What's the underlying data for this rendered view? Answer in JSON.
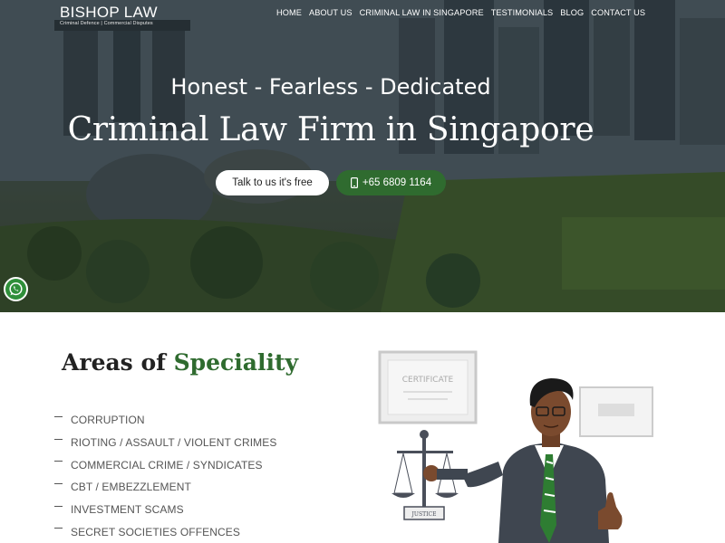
{
  "header": {
    "logo_name": "BISHOP LAW",
    "logo_tagline": "Criminal Defence | Commercial Disputes",
    "nav": [
      {
        "label": "HOME"
      },
      {
        "label": "ABOUT US"
      },
      {
        "label": "CRIMINAL LAW IN SINGAPORE"
      },
      {
        "label": "TESTIMONIALS"
      },
      {
        "label": "BLOG"
      },
      {
        "label": "CONTACT US"
      }
    ]
  },
  "hero": {
    "tagline": "Honest - Fearless - Dedicated",
    "headline": "Criminal Law Firm in Singapore",
    "cta_talk": "Talk to us it's free",
    "cta_phone": "+65 6809 1164",
    "phone_icon": "mobile-phone-icon",
    "whatsapp_icon": "whatsapp-icon"
  },
  "areas": {
    "title_prefix": "Areas of ",
    "title_accent": "Speciality",
    "items": [
      "CORRUPTION",
      "RIOTING / ASSAULT / VIOLENT CRIMES",
      "COMMERCIAL CRIME / SYNDICATES",
      "CBT / EMBEZZLEMENT",
      "INVESTMENT SCAMS",
      "SECRET SOCIETIES OFFENCES"
    ]
  },
  "illustration": {
    "certificate_label": "CERTIFICATE",
    "scale_label": "JUSTICE"
  },
  "colors": {
    "accent_green": "#2f6b2f",
    "whatsapp_green": "#2f8f3a",
    "text_dark": "#222222"
  }
}
